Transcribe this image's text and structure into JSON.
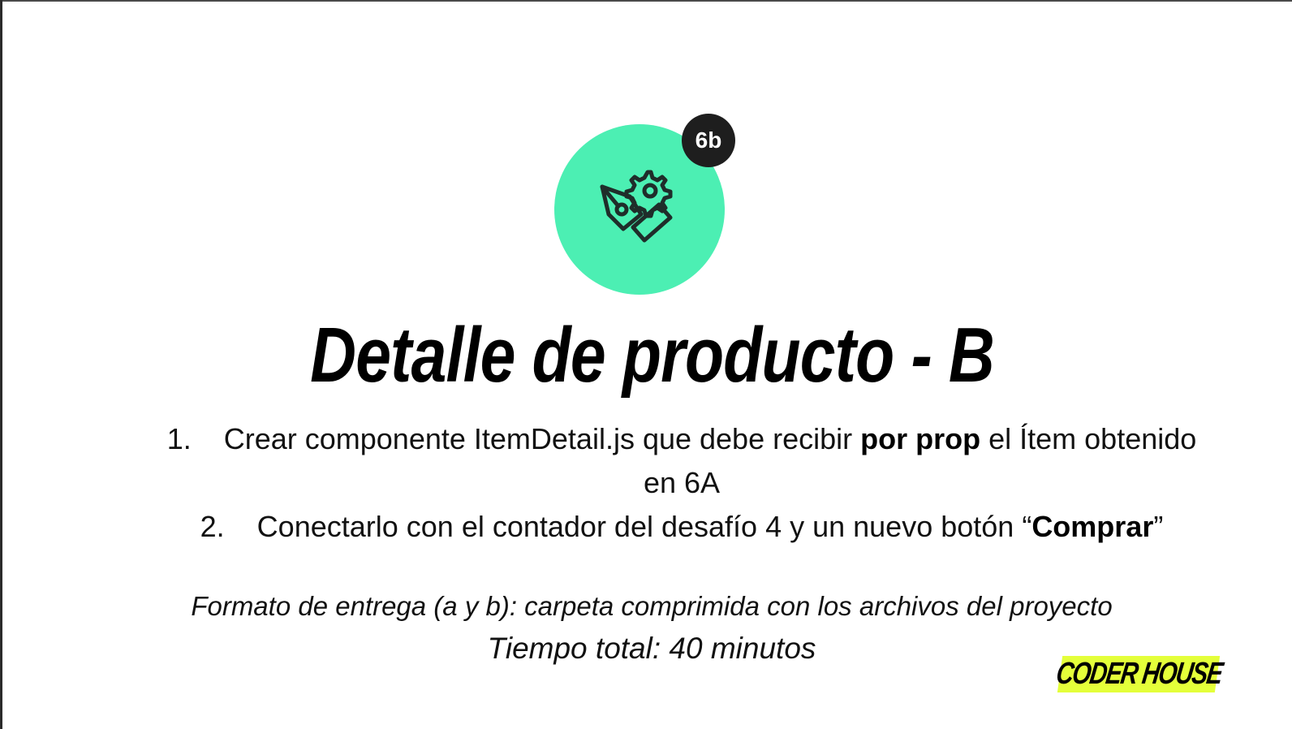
{
  "slide": {
    "badge": "6b",
    "icon": "pen-gear-icon",
    "accent_color": "#4cefb3",
    "title": "Detalle de producto - B",
    "items": [
      {
        "number": "1.",
        "text_before": "Crear componente ItemDetail.js que debe recibir ",
        "bold": "por prop",
        "text_after": " el Ítem obtenido en 6A"
      },
      {
        "number": "2.",
        "text_before": "Conectarlo con el contador del desafío 4 y un nuevo botón “",
        "bold": "Comprar",
        "text_after": "”"
      }
    ],
    "format": "Formato de entrega (a y b): carpeta comprimida con los archivos del proyecto",
    "time": "Tiempo total: 40 minutos"
  },
  "logo": {
    "text": "CODER HOUSE",
    "color": "#e4ff3a"
  }
}
